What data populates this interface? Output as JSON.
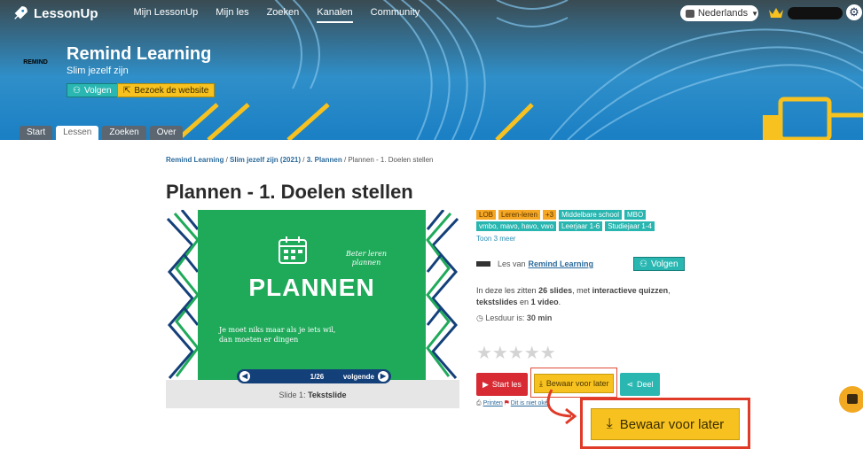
{
  "topbar": {
    "logo": "LessonUp",
    "nav": [
      "Mijn LessonUp",
      "Mijn les",
      "Zoeken",
      "Kanalen",
      "Community"
    ],
    "active_nav": "Kanalen",
    "language": "Nederlands"
  },
  "channel": {
    "avatar_text": "REMIND",
    "title": "Remind Learning",
    "subtitle": "Slim jezelf zijn",
    "follow_label": "Volgen",
    "visit_label": "Bezoek de website",
    "tabs": [
      "Start",
      "Lessen",
      "Zoeken",
      "Over"
    ],
    "active_tab": "Lessen"
  },
  "breadcrumb": {
    "items": [
      "Remind Learning",
      "Slim jezelf zijn (2021)",
      "3. Plannen"
    ],
    "current": "Plannen - 1. Doelen stellen"
  },
  "lesson": {
    "title": "Plannen - 1. Doelen stellen",
    "slide": {
      "handwritten": "Beter leren plannen",
      "heading": "PLANNEN",
      "body_line1": "Je moet niks maar als je iets wil,",
      "body_line2": "dan moeten er dingen",
      "counter": "1/26",
      "next_label": "volgende",
      "caption_prefix": "Slide 1:",
      "caption_type": "Tekstslide"
    },
    "tags": [
      {
        "label": "LOB",
        "color": "orange"
      },
      {
        "label": "Leren-leren",
        "color": "orange"
      },
      {
        "label": "+3",
        "color": "orange"
      },
      {
        "label": "Middelbare school",
        "color": "teal"
      },
      {
        "label": "MBO",
        "color": "teal"
      },
      {
        "label": "vmbo, mavo, havo, vwo",
        "color": "teal"
      },
      {
        "label": "Leerjaar 1-6",
        "color": "teal"
      },
      {
        "label": "Studiejaar 1-4",
        "color": "teal"
      }
    ],
    "show_more": "Toon 3 meer",
    "author_prefix": "Les van",
    "author": "Remind Learning",
    "follow_label": "Volgen",
    "desc": {
      "p1": "In deze les zitten",
      "slides": "26 slides",
      "p2": ", met",
      "quizzes": "interactieve quizzen",
      "p3": ",",
      "textslides": "tekstslides",
      "p4": "en",
      "video": "1 video",
      "p5": "."
    },
    "duration_label": "Lesduur is:",
    "duration_value": "30 min",
    "rating_stars": "★★★★★",
    "start_label": "Start les",
    "save_label": "Bewaar voor later",
    "share_label": "Deel",
    "print_label": "Printen",
    "report_label": "Dit is niet oké"
  },
  "callout": {
    "label": "Bewaar voor later"
  },
  "colors": {
    "banner": "#1f88c4",
    "slide_green": "#1faa5a",
    "accent_yellow": "#f7c21f",
    "teal": "#2ab7b2",
    "red": "#d72a33"
  }
}
